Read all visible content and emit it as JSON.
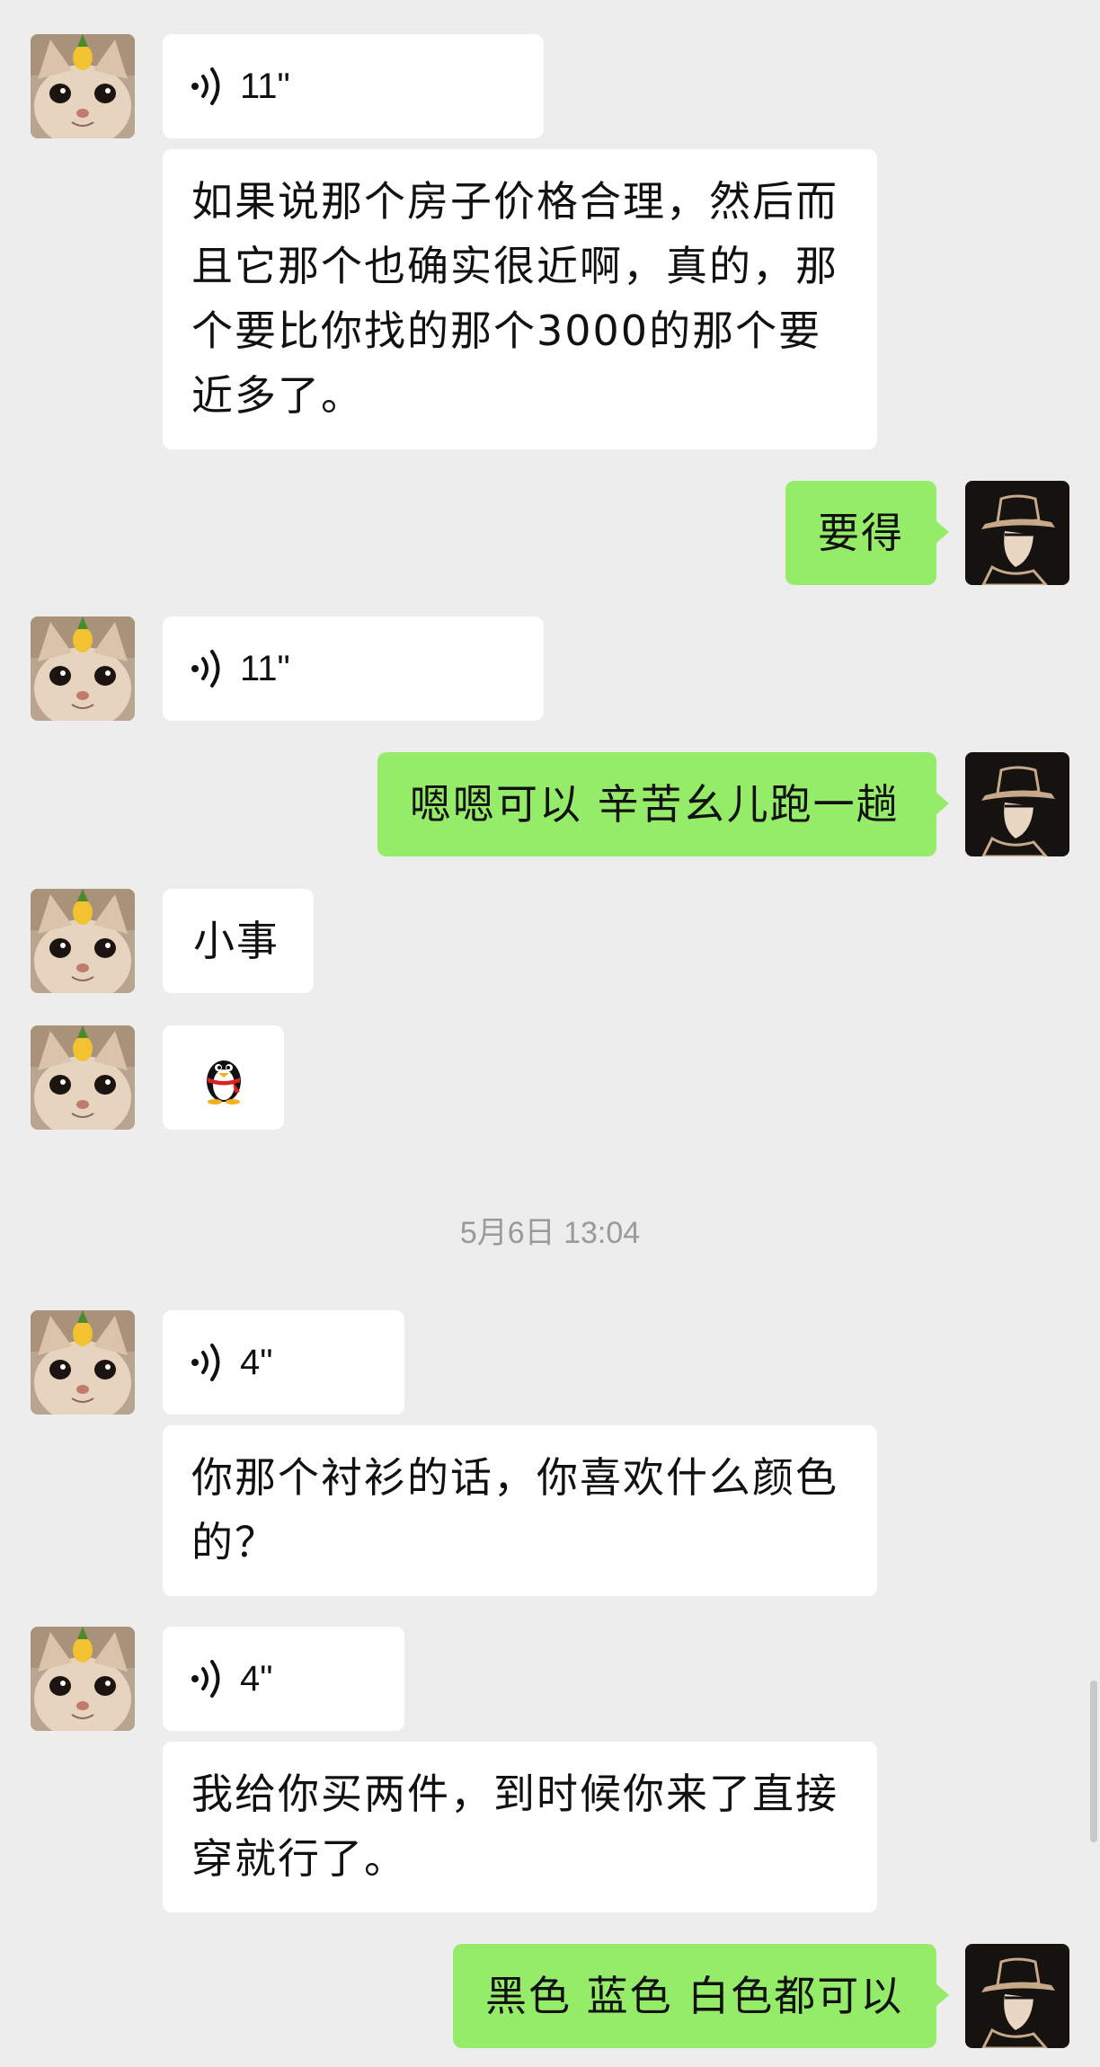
{
  "messages": [
    {
      "type": "voice",
      "duration": "11\""
    },
    {
      "type": "text",
      "text": "如果说那个房子价格合理，然后而\n且它那个也确实很近啊，真的，那\n个要比你找的那个3000的那个要\n近多了。"
    },
    {
      "type": "text",
      "text": "要得"
    },
    {
      "type": "voice",
      "duration": "11\""
    },
    {
      "type": "text",
      "text": "嗯嗯可以 辛苦幺儿跑一趟"
    },
    {
      "type": "text",
      "text": "小事"
    },
    {
      "type": "sticker",
      "sticker": "penguin-emoji"
    },
    {
      "type": "voice",
      "duration": "4\""
    },
    {
      "type": "text",
      "text": "你那个衬衫的话，你喜欢什么颜色\n的？"
    },
    {
      "type": "voice",
      "duration": "4\""
    },
    {
      "type": "text",
      "text": "我给你买两件，到时候你来了直接\n穿就行了。"
    },
    {
      "type": "text",
      "text": "黑色 蓝色 白色都可以"
    }
  ],
  "timestamp": "5月6日 13:04",
  "colors": {
    "background": "#ededed",
    "incoming_bubble": "#ffffff",
    "outgoing_bubble": "#95ec69",
    "timestamp_text": "#9a9a9a"
  }
}
